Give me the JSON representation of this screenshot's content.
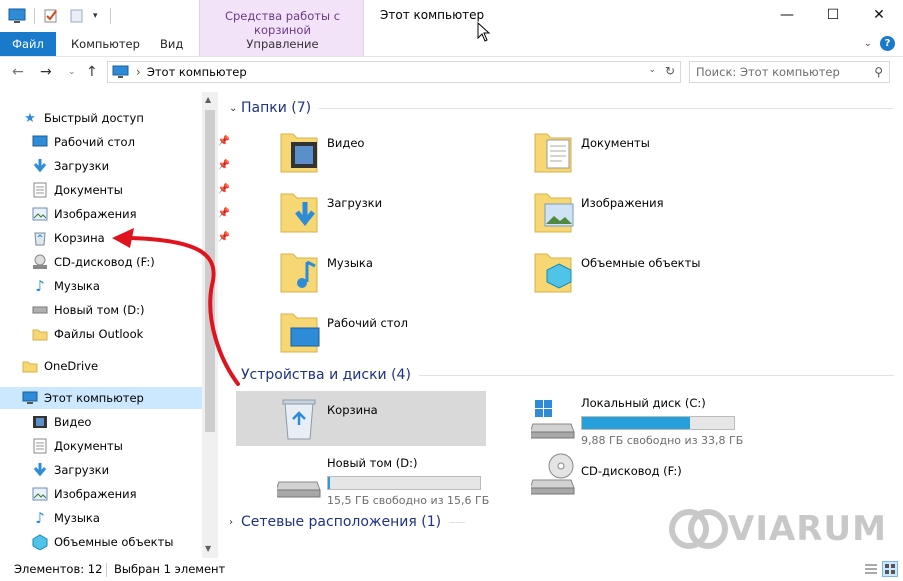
{
  "window": {
    "title": "Этот компьютер",
    "context_group": "Средства работы с корзиной",
    "context_tab": "Управление",
    "minimize": "—",
    "maximize": "☐",
    "close": "✕"
  },
  "ribbon": {
    "tabs": [
      "Файл",
      "Компьютер",
      "Вид"
    ],
    "expand_icon": "chevron-down-icon",
    "help_label": "?"
  },
  "address": {
    "path": "Этот компьютер",
    "separator": "›",
    "search_placeholder": "Поиск: Этот компьютер"
  },
  "nav": {
    "quick_access": "Быстрый доступ",
    "quick_items": [
      {
        "label": "Рабочий стол",
        "pinned": true
      },
      {
        "label": "Загрузки",
        "pinned": true
      },
      {
        "label": "Документы",
        "pinned": true
      },
      {
        "label": "Изображения",
        "pinned": true
      },
      {
        "label": "Корзина",
        "pinned": true
      },
      {
        "label": "CD-дисковод (F:)",
        "pinned": false
      },
      {
        "label": "Музыка",
        "pinned": false
      },
      {
        "label": "Новый том (D:)",
        "pinned": false
      },
      {
        "label": "Файлы Outlook",
        "pinned": false
      }
    ],
    "onedrive": "OneDrive",
    "this_pc": "Этот компьютер",
    "pc_items": [
      "Видео",
      "Документы",
      "Загрузки",
      "Изображения",
      "Музыка",
      "Объемные объекты"
    ]
  },
  "content": {
    "folders_header": "Папки (7)",
    "folders": [
      "Видео",
      "Документы",
      "Загрузки",
      "Изображения",
      "Музыка",
      "Объемные объекты",
      "Рабочий стол"
    ],
    "devices_header": "Устройства и диски (4)",
    "devices": [
      {
        "label": "Корзина"
      },
      {
        "label": "Локальный диск (C:)",
        "free": "9,88 ГБ свободно из 33,8 ГБ",
        "used_fraction": 0.708
      },
      {
        "label": "Новый том (D:)",
        "free": "15,5 ГБ свободно из 15,6 ГБ",
        "used_fraction": 0.006
      },
      {
        "label": "CD-дисковод (F:)"
      }
    ],
    "network_header": "Сетевые расположения (1)"
  },
  "status": {
    "items": "Элементов: 12",
    "selected": "Выбран 1 элемент"
  },
  "watermark": "VIARUM",
  "colors": {
    "accent": "#1979ca",
    "drive_fill": "#26a0da",
    "annotation_arrow": "#e0141e",
    "folder": "#f7d774"
  }
}
